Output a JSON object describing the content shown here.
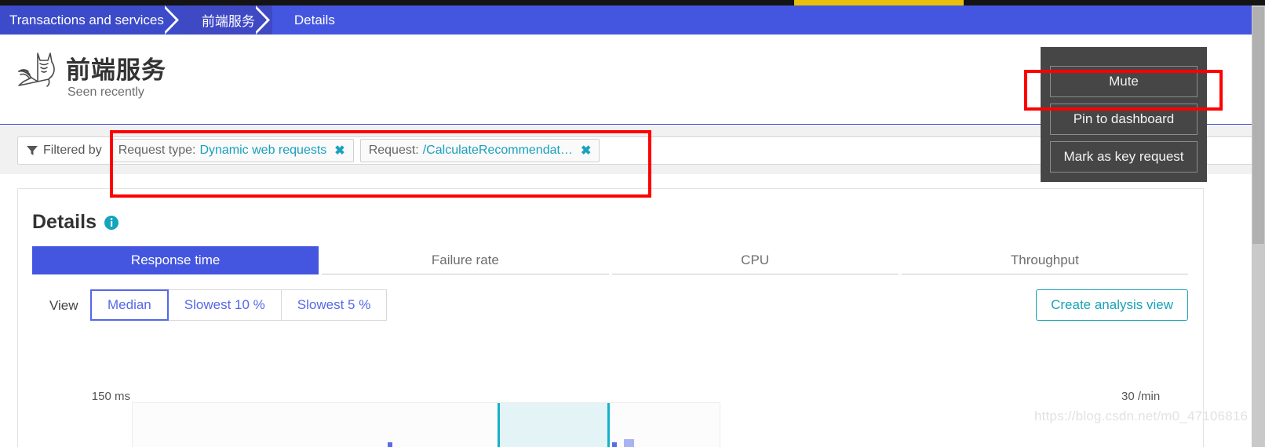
{
  "topstrip": {
    "accent_color": "#e8bf0b",
    "bar_color": "#141414"
  },
  "breadcrumb": {
    "items": [
      {
        "label": "Transactions and services",
        "color": "#3b4bc9"
      },
      {
        "label": "前端服务",
        "color": "#3f49c4"
      },
      {
        "label": "Details",
        "color": "#4456e0"
      }
    ]
  },
  "header": {
    "title": "前端服务",
    "subtitle": "Seen recently",
    "logo_icon": "cat-logo-icon"
  },
  "filters": {
    "filter_icon": "funnel-icon",
    "label": "Filtered by",
    "chips": [
      {
        "key": "Request type:",
        "value": "Dynamic web requests",
        "remove_icon": "close-icon"
      },
      {
        "key": "Request:",
        "value": "/CalculateRecommendat…",
        "remove_icon": "close-icon"
      }
    ]
  },
  "details": {
    "title": "Details",
    "info_icon": "info-icon",
    "tabs": [
      {
        "label": "Response time",
        "active": true
      },
      {
        "label": "Failure rate",
        "active": false
      },
      {
        "label": "CPU",
        "active": false
      },
      {
        "label": "Throughput",
        "active": false
      }
    ],
    "view": {
      "label": "View",
      "options": [
        {
          "label": "Median",
          "active": true
        },
        {
          "label": "Slowest 10 %",
          "active": false
        },
        {
          "label": "Slowest 5 %",
          "active": false
        }
      ]
    },
    "create_analysis_view": "Create analysis view"
  },
  "menu": {
    "items": [
      {
        "label": "Mute"
      },
      {
        "label": "Pin to dashboard"
      },
      {
        "label": "Mark as key request"
      }
    ]
  },
  "watermark": {
    "text": "https://blog.csdn.net/m0_47106816"
  },
  "colors": {
    "primary_blue": "#4456e0",
    "accent_teal": "#17a2b8",
    "link_blue": "#5568e8",
    "annotation_red": "#ff0000",
    "menu_background": "#464646"
  },
  "chart_data": {
    "type": "bar",
    "title": "",
    "xlabel": "",
    "ylabel": "",
    "y_left_label": "150 ms",
    "y_right_label": "30 /min",
    "ylim": [
      0,
      150
    ],
    "y2lim": [
      0,
      30
    ],
    "grid": false,
    "legend": "none",
    "selection": {
      "start_pct": 62,
      "end_pct": 81,
      "color": "#14b2c8"
    },
    "series": [
      {
        "name": "Response time",
        "unit": "ms",
        "color": "#5a6ae8",
        "points": [
          {
            "x_pct": 43.5,
            "value": 12
          },
          {
            "x_pct": 81.5,
            "value": 12
          }
        ]
      },
      {
        "name": "Throughput",
        "unit": "/min",
        "color": "#a9b3f2",
        "points": [
          {
            "x_pct": 83.5,
            "value": 9
          }
        ]
      }
    ]
  }
}
